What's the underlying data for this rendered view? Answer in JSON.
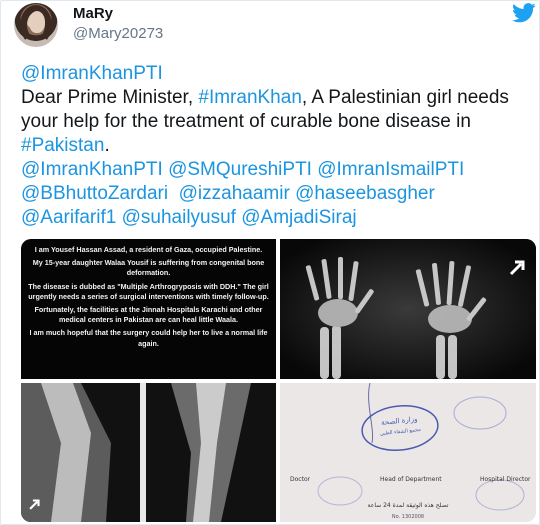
{
  "tweet": {
    "display_name": "MaRy",
    "handle": "@Mary20273",
    "text_parts": [
      {
        "t": "mention",
        "v": "@ImranKhanPTI"
      },
      {
        "t": "text",
        "v": "Dear Prime Minister, "
      },
      {
        "t": "mention",
        "v": "#ImranKhan"
      },
      {
        "t": "text",
        "v": ", A Palestinian girl needs your help for the treatment of curable bone disease in "
      },
      {
        "t": "mention",
        "v": "#Pakistan"
      },
      {
        "t": "text",
        "v": "."
      },
      {
        "t": "mention",
        "v": "@ImranKhanPTI"
      },
      {
        "t": "mention",
        "v": "@SMQureshiPTI"
      },
      {
        "t": "mention",
        "v": "@ImranIsmailPTI"
      },
      {
        "t": "mention",
        "v": "@BBhuttoZardari"
      },
      {
        "t": "mention",
        "v": "@izzahaamir"
      },
      {
        "t": "mention",
        "v": "@haseebasgher"
      },
      {
        "t": "mention",
        "v": "@Aarifarif1"
      },
      {
        "t": "mention",
        "v": "@suhailyusuf"
      },
      {
        "t": "mention",
        "v": "@AmjadiSiraj"
      }
    ]
  },
  "media": {
    "letter": [
      "I am Yousef Hassan Assad, a resident of Gaza, occupied Palestine.",
      "My 15-year daughter Walaa Yousif is suffering from congenital bone deformation.",
      "The disease is dubbed as \"Multiple Arthrogryposis with DDH.\" The girl urgently needs a series of surgical interventions with timely follow-up.",
      "Fortunately, the facilities at the Jinnah Hospitals Karachi and other medical centers in Pakistan are can heal little Waala.",
      "I am much hopeful that the surgery could help her to live a normal life again."
    ],
    "document": {
      "stamp": "وزارة الصحة الإدارة العامة للمستشفيات مجمع الشفاء الطبي - غزة",
      "label_doctor": "Doctor",
      "label_head": "Head of Department",
      "label_director": "Hospital Director",
      "arabic_line": "تصلح هذه الوثيقة لمدة 24 ساعة",
      "serial": "No. 1302008"
    }
  },
  "icons": [
    "twitter-bird-icon",
    "expand-icon"
  ],
  "colors": {
    "link": "#1b95e0",
    "text": "#14171a",
    "muted": "#657786",
    "bird": "#1da1f2"
  }
}
